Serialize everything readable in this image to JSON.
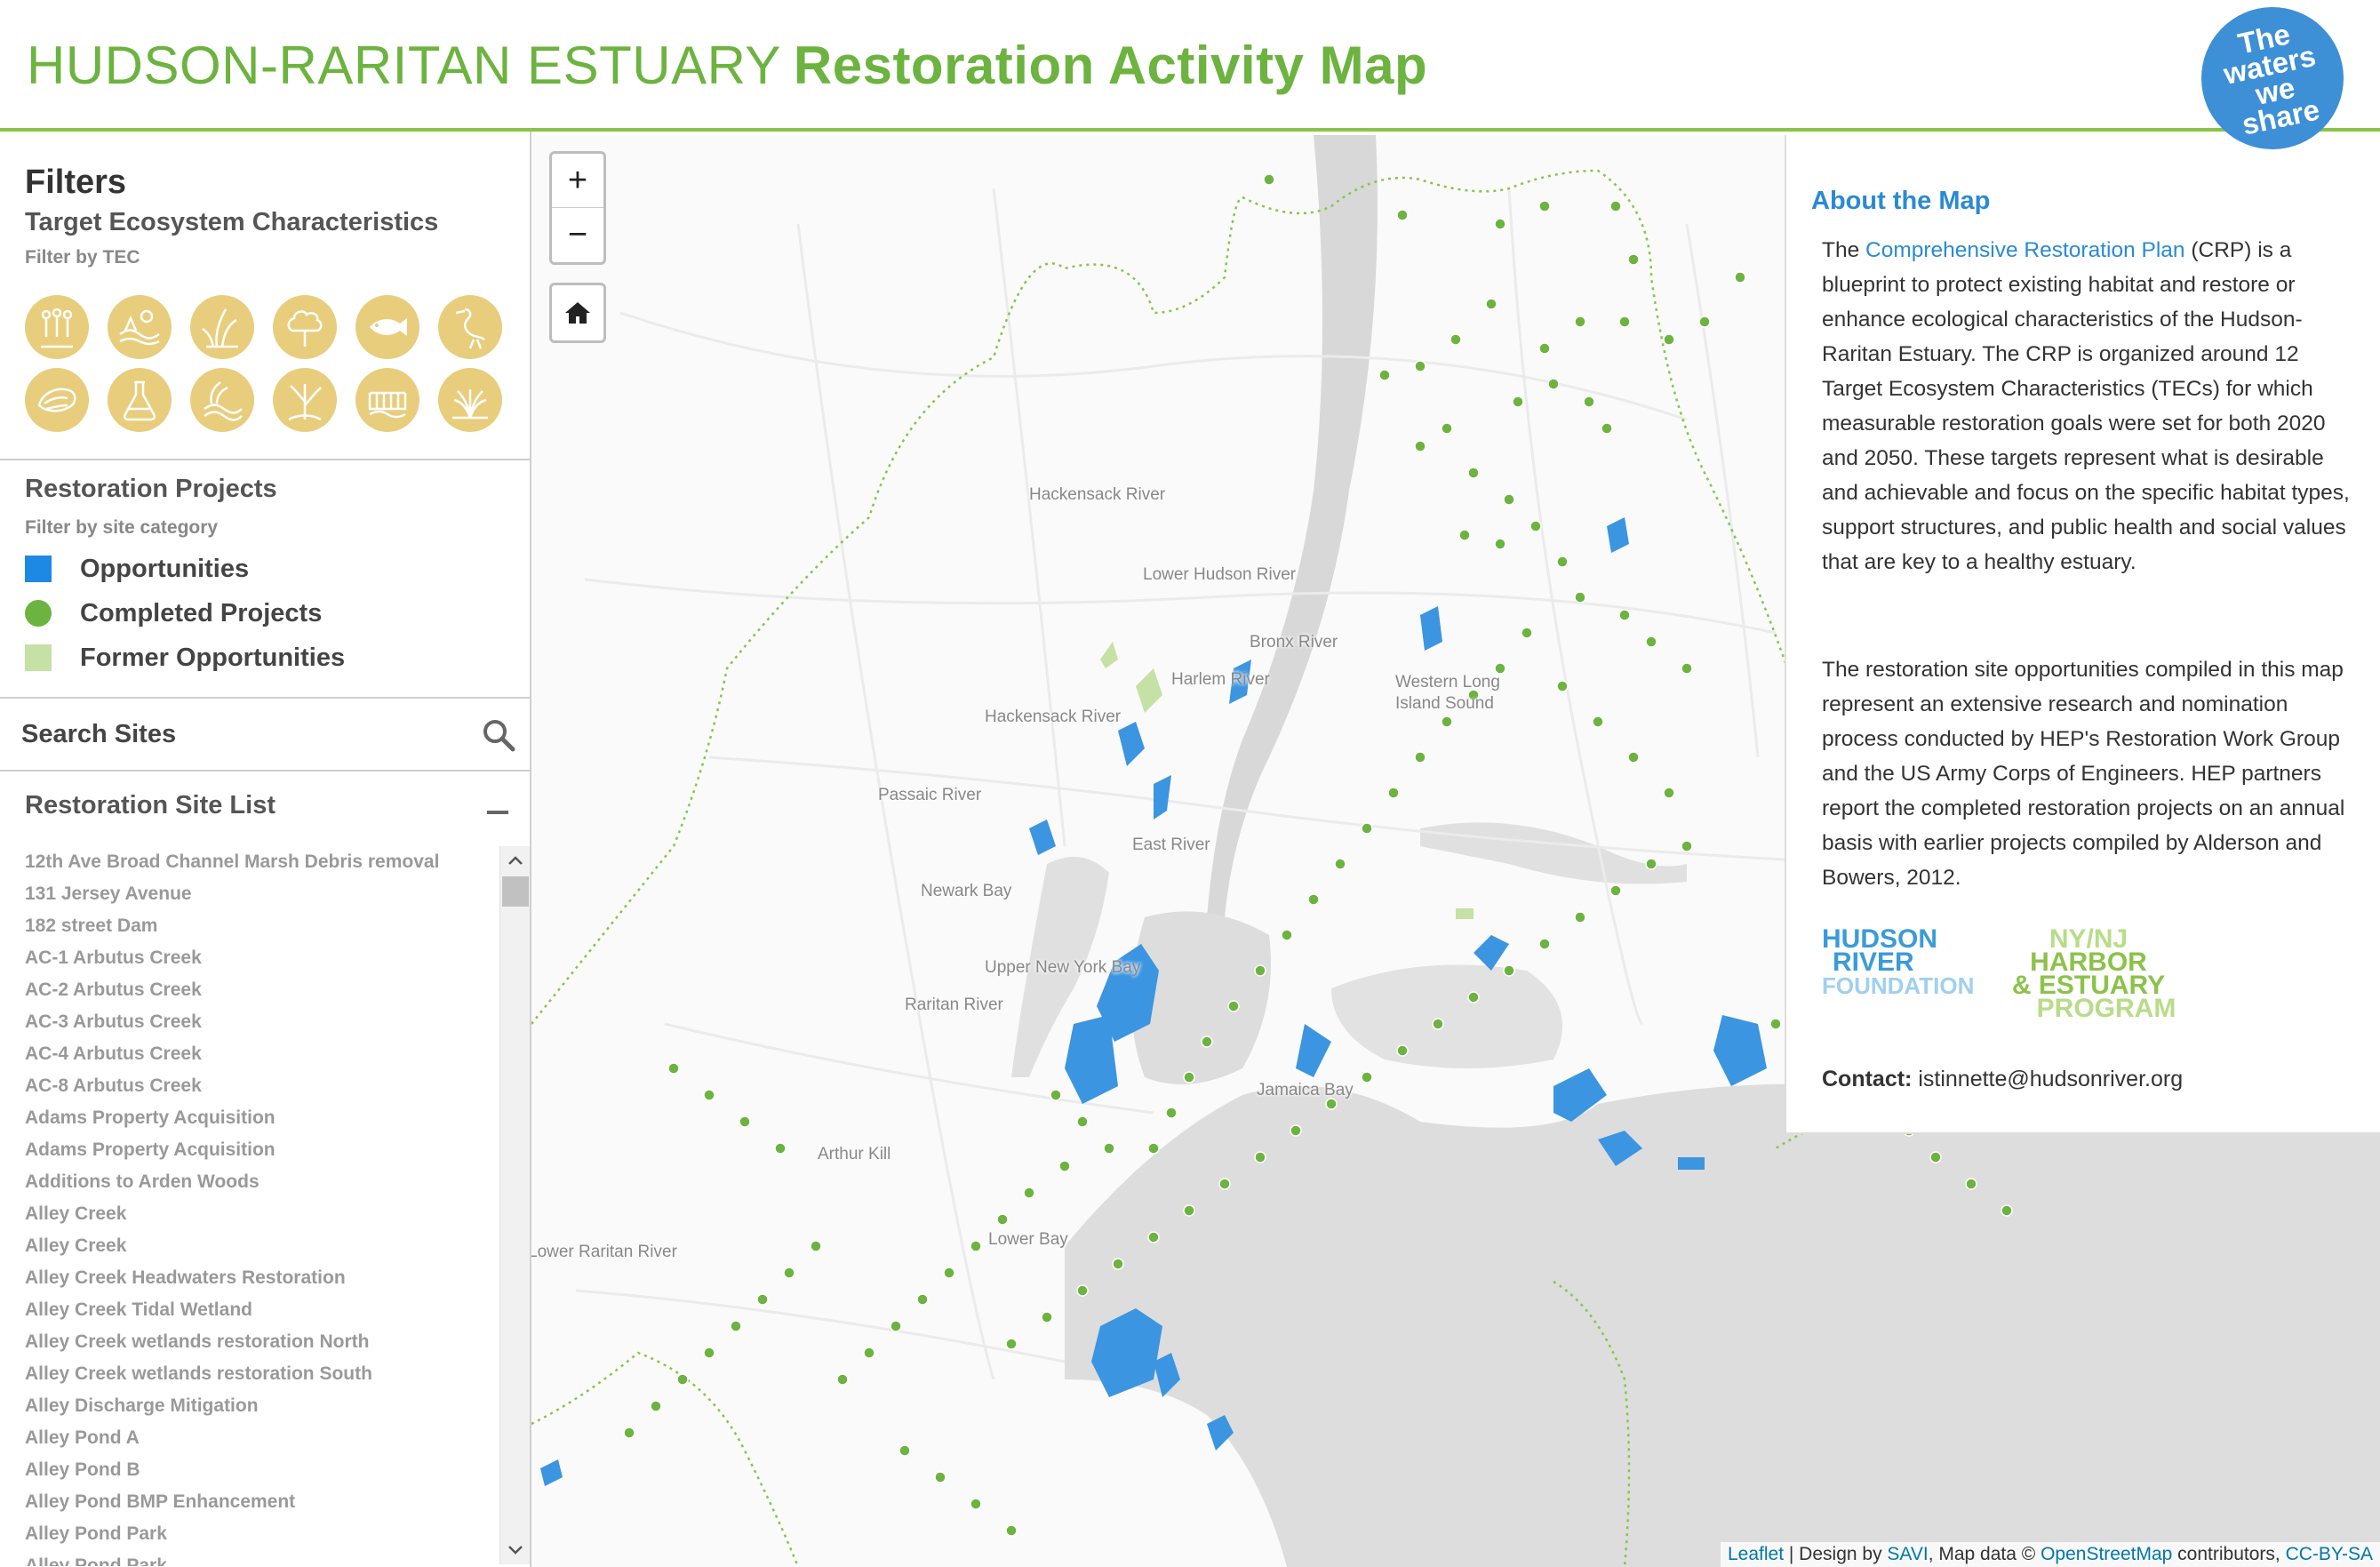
{
  "header": {
    "title_light": "HUDSON-RARITAN ESTUARY",
    "title_bold": "Restoration Activity Map",
    "logo_lines": [
      "The",
      "waters",
      "we",
      "share"
    ]
  },
  "filters": {
    "title": "Filters",
    "tec_title": "Target Ecosystem Characteristics",
    "tec_subtitle": "Filter by TEC",
    "tec_icons": [
      "people-icon",
      "shore-icon",
      "wetland-grass-icon",
      "tree-icon",
      "fish-icon",
      "heron-bird-icon",
      "oyster-icon",
      "flask-icon",
      "waves-icon",
      "coastal-habitat-icon",
      "bulkhead-shoreline-icon",
      "eelgrass-icon"
    ],
    "tec_color": "#e8cd7d"
  },
  "restoration_projects": {
    "title": "Restoration Projects",
    "subtitle": "Filter by site category",
    "legend": [
      {
        "label": "Opportunities",
        "color": "#1e88e5",
        "shape": "square"
      },
      {
        "label": "Completed Projects",
        "color": "#6cb33f",
        "shape": "circle"
      },
      {
        "label": "Former Opportunities",
        "color": "#c5e1a5",
        "shape": "square"
      }
    ]
  },
  "search": {
    "placeholder": "Search Sites"
  },
  "site_list": {
    "title": "Restoration Site List",
    "items": [
      "12th Ave Broad Channel Marsh Debris removal",
      "131 Jersey Avenue",
      "182 street Dam",
      "AC-1 Arbutus Creek",
      "AC-2 Arbutus Creek",
      "AC-3 Arbutus Creek",
      "AC-4 Arbutus Creek",
      "AC-8 Arbutus Creek",
      "Adams Property Acquisition",
      "Adams Property Acquisition",
      "Additions to Arden Woods",
      "Alley Creek",
      "Alley Creek",
      "Alley Creek Headwaters Restoration",
      "Alley Creek Tidal Wetland",
      "Alley Creek wetlands restoration North",
      "Alley Creek wetlands restoration South",
      "Alley Discharge Mitigation",
      "Alley Pond A",
      "Alley Pond B",
      "Alley Pond BMP Enhancement",
      "Alley Pond Park",
      "Alley Pond Park"
    ]
  },
  "map": {
    "zoom_in": "+",
    "zoom_out": "−",
    "labels": [
      "Hackensack River",
      "Lower Hudson River",
      "Bronx River",
      "Harlem River",
      "Western Long Island Sound",
      "Hackensack River",
      "Passaic River",
      "East River",
      "Newark Bay",
      "Upper New York Bay",
      "Raritan River",
      "Jamaica Bay",
      "Arthur Kill",
      "Lower Raritan River",
      "Lower Bay"
    ],
    "attribution": {
      "leaflet": "Leaflet",
      "design_by": " | Design by ",
      "savi": "SAVI",
      "map_data": ", Map data © ",
      "osm": "OpenStreetMap",
      "contributors": " contributors, ",
      "license": "CC-BY-SA"
    }
  },
  "about": {
    "title": "About the Map",
    "p1_before": "The ",
    "p1_link": "Comprehensive Restoration Plan",
    "p1_after": " (CRP) is a blueprint to protect existing habitat and restore or enhance ecological characteristics of the Hudson-Raritan Estuary. The CRP is organized around 12 Target Ecosystem Characteristics (TECs) for which measurable restoration goals were set for both 2020 and 2050. These targets represent what is desirable and achievable and focus on the specific habitat types, support structures, and public health and social values that are key to a healthy estuary.",
    "p2": "The restoration site opportunities compiled in this map represent an extensive research and nomination process conducted by HEP's Restoration Work Group and the US Army Corps of Engineers. HEP partners report the completed restoration projects on an annual basis with earlier projects compiled by Alderson and Bowers, 2012.",
    "hrf_logo": [
      "HUDSON",
      "RIVER",
      "FOUNDATION"
    ],
    "hep_logo": [
      "NY/NJ",
      "HARBOR",
      "& ESTUARY",
      "PROGRAM"
    ],
    "contact_label": "Contact:",
    "contact_value": "istinnette@hudsonriver.org"
  }
}
